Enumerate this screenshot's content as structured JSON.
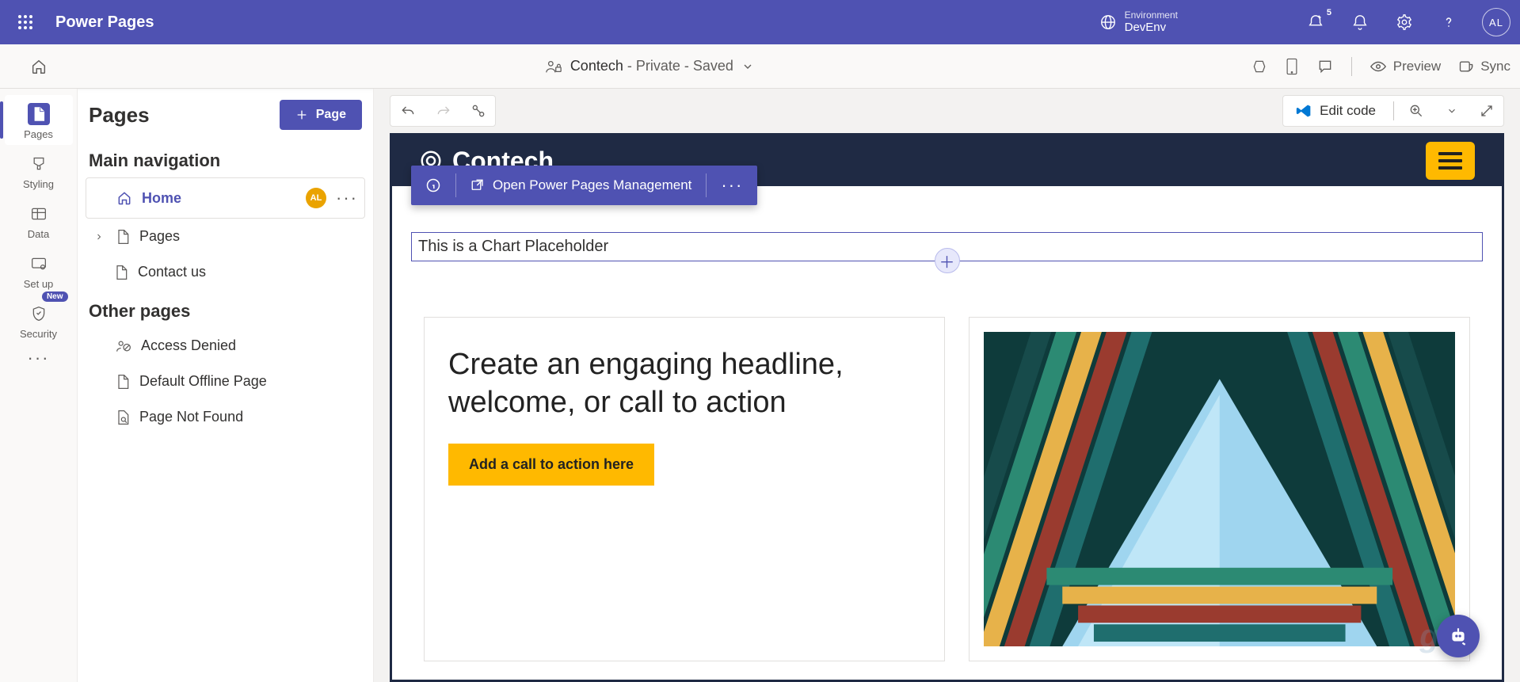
{
  "suitebar": {
    "app_title": "Power Pages",
    "environment_label": "Environment",
    "environment_name": "DevEnv",
    "notification_count": "5",
    "avatar_initials": "AL"
  },
  "cmdbar": {
    "site_name": "Contech",
    "site_status": " - Private - Saved",
    "preview_label": "Preview",
    "sync_label": "Sync"
  },
  "rail": {
    "pages": "Pages",
    "styling": "Styling",
    "data": "Data",
    "setup": "Set up",
    "security": "Security",
    "new_badge": "New"
  },
  "pagesPanel": {
    "title": "Pages",
    "add_button": "Page",
    "main_nav_header": "Main navigation",
    "other_pages_header": "Other pages",
    "mainNav": [
      {
        "label": "Home",
        "badge": "AL"
      },
      {
        "label": "Pages"
      },
      {
        "label": "Contact us"
      }
    ],
    "otherPages": [
      {
        "label": "Access Denied"
      },
      {
        "label": "Default Offline Page"
      },
      {
        "label": "Page Not Found"
      }
    ]
  },
  "canvasToolbar": {
    "edit_code": "Edit code"
  },
  "contextStrip": {
    "open_mgmt": "Open Power Pages Management"
  },
  "stage": {
    "site_title": "Contech",
    "placeholder_text": "This is a Chart Placeholder",
    "hero_title": "Create an engaging headline, welcome, or call to action",
    "cta_label": "Add a call to action here"
  }
}
